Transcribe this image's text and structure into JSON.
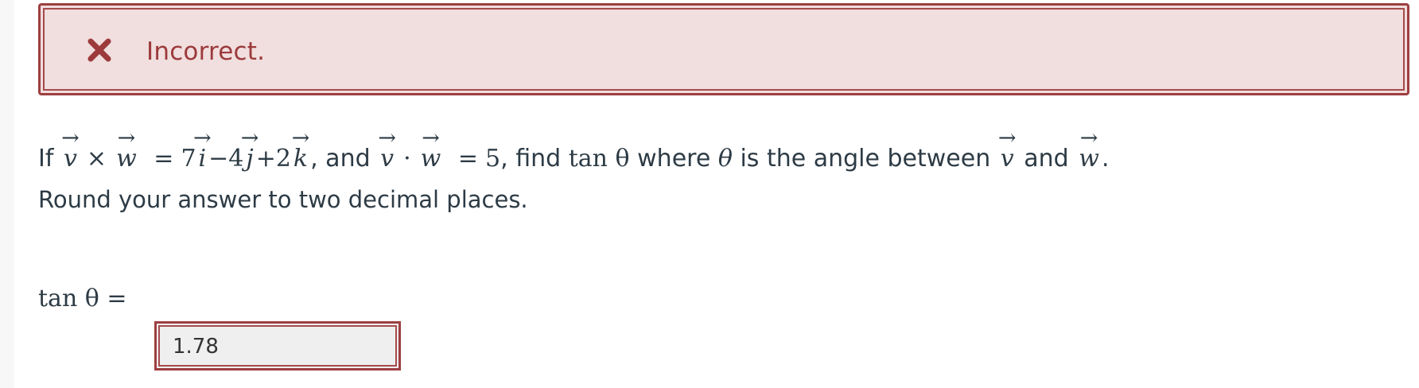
{
  "feedback": {
    "status": "Incorrect.",
    "icon": "x-mark-icon",
    "color": "#9c3a3c",
    "background": "#f1dede"
  },
  "question": {
    "if_word": "If",
    "v": "v",
    "w": "w",
    "cross_op": "×",
    "equals": "=",
    "coef_i": "7",
    "i": "i",
    "coef_j": "−4",
    "j": "j",
    "coef_k": "+2",
    "k": "k",
    "and_text": ", and",
    "dot_op": "·",
    "dot_value": "5",
    "find_text": ", find",
    "tan_expr": "tan θ",
    "where_text": "where",
    "theta": "θ",
    "angle_text": "is the angle between",
    "and_word": "and",
    "period": "."
  },
  "instruction": "Round your answer to two decimal places.",
  "answer": {
    "label": "tan θ =",
    "value": "1.78"
  }
}
